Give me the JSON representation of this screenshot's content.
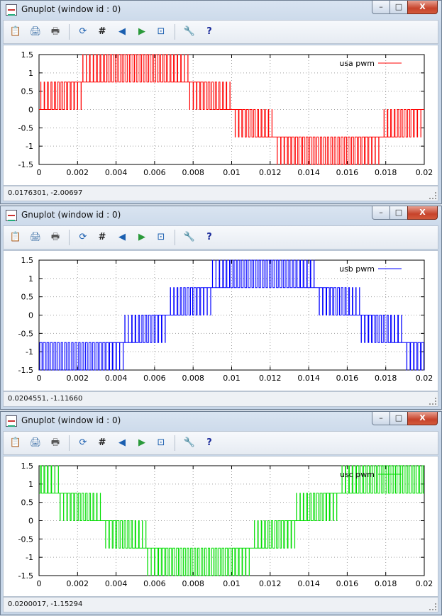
{
  "windows": [
    {
      "title": "Gnuplot (window id : 0)",
      "status": "0.0176301, -2.00697",
      "legend": "usa pwm",
      "color": "#ff0000",
      "buttons": {
        "minimize": "–",
        "maximize": "□",
        "close": "X"
      },
      "toolbar_icons": [
        "clipboard-icon",
        "print-preview-icon",
        "printer-icon",
        "replot-icon",
        "grid-icon",
        "zoom-previous-icon",
        "zoom-next-icon",
        "autoscale-icon",
        "options-icon",
        "help-icon"
      ]
    },
    {
      "title": "Gnuplot (window id : 0)",
      "status": "0.0204551, -1.11660",
      "legend": "usb pwm",
      "color": "#0000ff",
      "buttons": {
        "minimize": "–",
        "maximize": "□",
        "close": "X"
      },
      "toolbar_icons": [
        "clipboard-icon",
        "print-preview-icon",
        "printer-icon",
        "replot-icon",
        "grid-icon",
        "zoom-previous-icon",
        "zoom-next-icon",
        "autoscale-icon",
        "options-icon",
        "help-icon"
      ]
    },
    {
      "title": "Gnuplot (window id : 0)",
      "status": "0.0200017, -1.15294",
      "legend": "usc pwm",
      "color": "#00dd00",
      "buttons": {
        "minimize": "–",
        "maximize": "□",
        "close": "X"
      },
      "toolbar_icons": [
        "clipboard-icon",
        "print-preview-icon",
        "printer-icon",
        "replot-icon",
        "grid-icon",
        "zoom-previous-icon",
        "zoom-next-icon",
        "autoscale-icon",
        "options-icon",
        "help-icon"
      ]
    }
  ],
  "chart_data": [
    {
      "type": "line",
      "series": [
        {
          "name": "usa pwm",
          "phase_deg": 0
        }
      ],
      "x_range": [
        0,
        0.02
      ],
      "y_range": [
        -1.5,
        1.5
      ],
      "x_ticks": [
        "0",
        "0.002",
        "0.004",
        "0.006",
        "0.008",
        "0.01",
        "0.012",
        "0.014",
        "0.016",
        "0.018",
        "0.02"
      ],
      "y_ticks": [
        "1.5",
        "1",
        "0.5",
        "0",
        "-0.5",
        "-1",
        "-1.5"
      ],
      "levels": [
        -1.5,
        -0.75,
        0,
        0.75,
        1.5
      ],
      "grid": true,
      "legend_position": "top-right"
    },
    {
      "type": "line",
      "series": [
        {
          "name": "usb pwm",
          "phase_deg": -120
        }
      ],
      "x_range": [
        0,
        0.02
      ],
      "y_range": [
        -1.5,
        1.5
      ],
      "x_ticks": [
        "0",
        "0.002",
        "0.004",
        "0.006",
        "0.008",
        "0.01",
        "0.012",
        "0.014",
        "0.016",
        "0.018",
        "0.02"
      ],
      "y_ticks": [
        "1.5",
        "1",
        "0.5",
        "0",
        "-0.5",
        "-1",
        "-1.5"
      ],
      "levels": [
        -1.5,
        -0.75,
        0,
        0.75,
        1.5
      ],
      "grid": true,
      "legend_position": "top-right"
    },
    {
      "type": "line",
      "series": [
        {
          "name": "usc pwm",
          "phase_deg": 120
        }
      ],
      "x_range": [
        0,
        0.02
      ],
      "y_range": [
        -1.5,
        1.5
      ],
      "x_ticks": [
        "0",
        "0.002",
        "0.004",
        "0.006",
        "0.008",
        "0.01",
        "0.012",
        "0.014",
        "0.016",
        "0.018",
        "0.02"
      ],
      "y_ticks": [
        "1.5",
        "1",
        "0.5",
        "0",
        "-0.5",
        "-1",
        "-1.5"
      ],
      "levels": [
        -1.5,
        -0.75,
        0,
        0.75,
        1.5
      ],
      "grid": true,
      "legend_position": "top-right"
    }
  ]
}
